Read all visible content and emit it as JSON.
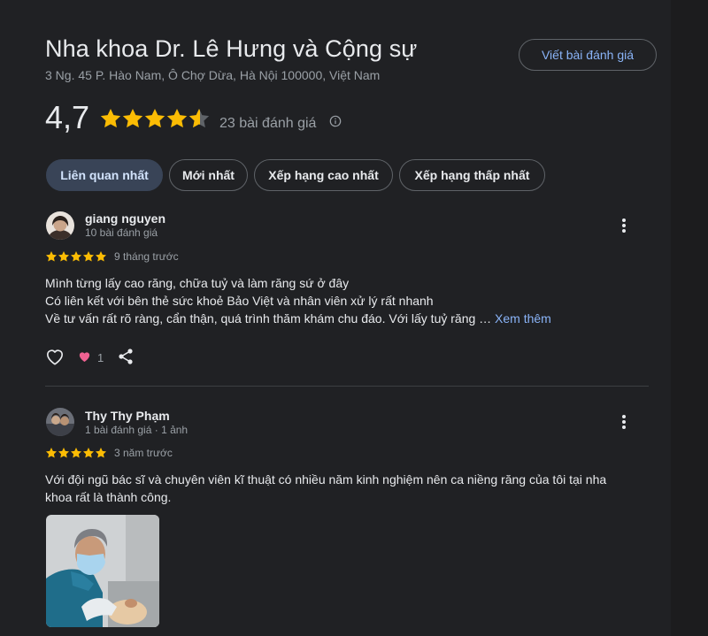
{
  "business": {
    "name": "Nha khoa Dr. Lê Hưng và Cộng sự",
    "address": "3 Ng. 45 P. Hào Nam, Ô Chợ Dừa, Hà Nội 100000, Việt Nam",
    "rating": "4,7",
    "stars": 4.7,
    "review_count": "23 bài đánh giá",
    "write_review_label": "Viết bài đánh giá"
  },
  "sort_tabs": [
    {
      "label": "Liên quan nhất",
      "active": true
    },
    {
      "label": "Mới nhất",
      "active": false
    },
    {
      "label": "Xếp hạng cao nhất",
      "active": false
    },
    {
      "label": "Xếp hạng thấp nhất",
      "active": false
    }
  ],
  "reviews": [
    {
      "name": "giang nguyen",
      "meta": "10 bài đánh giá",
      "stars": 5,
      "time": "9 tháng trước",
      "lines": [
        "Mình từng lấy cao răng, chữa tuỷ và làm răng sứ ở đây",
        "Có liên kết với bên thẻ sức khoẻ Bảo Việt và nhân viên xử lý rất nhanh",
        "Về tư vấn rất rõ ràng, cẩn thận, quá trình thăm khám chu đáo. Với lấy tuỷ răng …"
      ],
      "see_more": "Xem thêm",
      "likes": "1"
    },
    {
      "name": "Thy Thy Phạm",
      "meta": "1 bài đánh giá · 1 ảnh",
      "stars": 5,
      "time": "3 năm trước",
      "lines": [
        "Với đội ngũ bác sĩ và chuyên viên kĩ thuật có nhiều năm kinh nghiệm nên ca niềng răng của tôi tại nha",
        "khoa rất là thành công."
      ]
    }
  ],
  "colors": {
    "background": "#202124",
    "star": "#fbbc04",
    "link": "#8ab4f8",
    "active_chip": "#394457",
    "heart": "#f06292"
  }
}
